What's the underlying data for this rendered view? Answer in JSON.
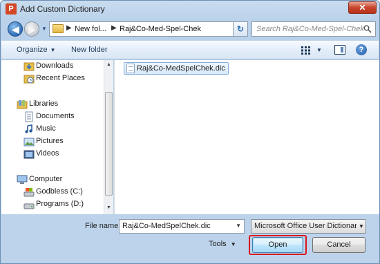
{
  "window": {
    "title": "Add Custom Dictionary",
    "app_icon_letter": "P",
    "close_symbol": "✕"
  },
  "nav": {
    "back_icon": "back-arrow-icon",
    "forward_icon": "forward-arrow-icon",
    "breadcrumbs": [
      "New fol...",
      "Raj&Co-Med-Spel-Chek"
    ],
    "refresh_symbol": "↻"
  },
  "search": {
    "placeholder": "Search Raj&Co-Med-Spel-Chek"
  },
  "toolbar": {
    "organize_label": "Organize",
    "new_folder_label": "New folder",
    "help_symbol": "?"
  },
  "sidebar": {
    "items": [
      {
        "label": "Downloads",
        "icon": "downloads-folder-icon"
      },
      {
        "label": "Recent Places",
        "icon": "recent-places-icon"
      },
      {
        "label": "Libraries",
        "icon": "libraries-icon"
      },
      {
        "label": "Documents",
        "icon": "documents-icon"
      },
      {
        "label": "Music",
        "icon": "music-icon"
      },
      {
        "label": "Pictures",
        "icon": "pictures-icon"
      },
      {
        "label": "Videos",
        "icon": "videos-icon"
      },
      {
        "label": "Computer",
        "icon": "computer-icon"
      },
      {
        "label": "Godbless (C:)",
        "icon": "drive-icon"
      },
      {
        "label": "Programs (D:)",
        "icon": "drive-icon"
      }
    ]
  },
  "files": [
    {
      "name": "Raj&Co-MedSpelChek.dic",
      "icon": "dictionary-file-icon",
      "selected": true
    }
  ],
  "footer": {
    "file_name_label": "File name:",
    "file_name_value": "Raj&Co-MedSpelChek.dic",
    "file_type_value": "Microsoft Office User Dictionary",
    "tools_label": "Tools",
    "open_label": "Open",
    "cancel_label": "Cancel"
  },
  "colors": {
    "highlight": "#d8161c",
    "accent": "#3c7fb1"
  }
}
